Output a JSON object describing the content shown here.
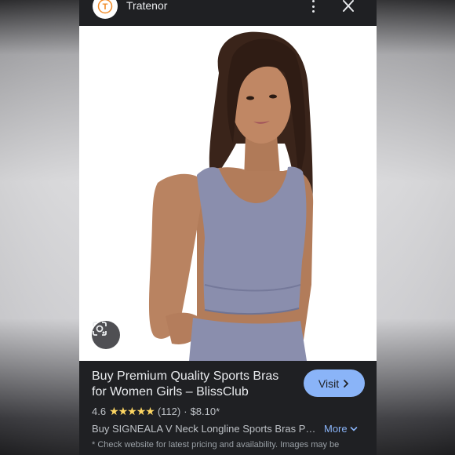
{
  "header": {
    "site_name": "Tratenor",
    "logo_letter": "T"
  },
  "product": {
    "title": "Buy Premium Quality Sports Bras for Women Girls – BlissClub",
    "visit_label": "Visit",
    "rating": "4.6",
    "stars": "★★★★★",
    "review_count": "(112)",
    "separator": "·",
    "price": "$8.10*",
    "description": "Buy SIGNEALA V Neck Longline Sports Bras Padded Yoga Crop Tops",
    "more_label": "More",
    "note": "* Check website for latest pricing and availability. Images may be"
  },
  "colors": {
    "accent": "#8ab4f8",
    "star": "#fdd663",
    "background": "#1f2023",
    "logo_orange": "#f28c28",
    "bra": "#8a8ead"
  },
  "icons": [
    "kebab-menu-icon",
    "close-icon",
    "lens-search-icon",
    "chevron-right-icon",
    "chevron-down-icon",
    "star-icon"
  ]
}
